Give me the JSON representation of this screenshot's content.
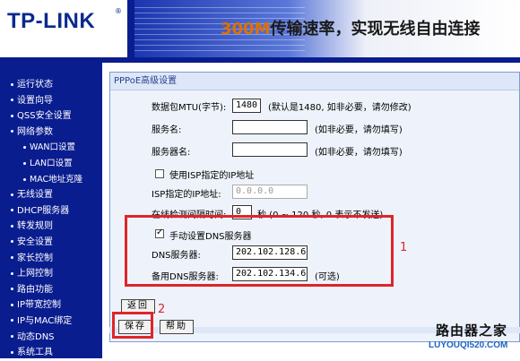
{
  "header": {
    "logo": "TP-LINK",
    "logo_mark": "®",
    "slogan_num": "300M",
    "slogan_text": "传输速率，实现无线自由连接"
  },
  "sidebar": {
    "items": [
      {
        "label": "运行状态",
        "sub": false
      },
      {
        "label": "设置向导",
        "sub": false
      },
      {
        "label": "QSS安全设置",
        "sub": false
      },
      {
        "label": "网络参数",
        "sub": false
      },
      {
        "label": "WAN口设置",
        "sub": true
      },
      {
        "label": "LAN口设置",
        "sub": true
      },
      {
        "label": "MAC地址克隆",
        "sub": true
      },
      {
        "label": "无线设置",
        "sub": false
      },
      {
        "label": "DHCP服务器",
        "sub": false
      },
      {
        "label": "转发规则",
        "sub": false
      },
      {
        "label": "安全设置",
        "sub": false
      },
      {
        "label": "家长控制",
        "sub": false
      },
      {
        "label": "上网控制",
        "sub": false
      },
      {
        "label": "路由功能",
        "sub": false
      },
      {
        "label": "IP带宽控制",
        "sub": false
      },
      {
        "label": "IP与MAC绑定",
        "sub": false
      },
      {
        "label": "动态DNS",
        "sub": false
      },
      {
        "label": "系统工具",
        "sub": false
      }
    ]
  },
  "panel": {
    "title": "PPPoE高级设置",
    "mtu_label": "数据包MTU(字节):",
    "mtu_value": "1480",
    "mtu_note": "(默认是1480, 如非必要，请勿修改)",
    "service_label": "服务名:",
    "service_note": "(如非必要，请勿填写)",
    "server_label": "服务器名:",
    "server_note": "(如非必要，请勿填写)",
    "isp_ip_check_label": "使用ISP指定的IP地址",
    "isp_ip_label": "ISP指定的IP地址:",
    "isp_ip_value": "0.0.0.0",
    "interval_label": "在线检测间隔时间:",
    "interval_value": "0",
    "interval_note": "秒 (0 ~ 120 秒, 0 表示不发送)",
    "dns_check_label": "手动设置DNS服务器",
    "dns_label": "DNS服务器:",
    "dns_value": "202.102.128.68",
    "dns2_label": "备用DNS服务器:",
    "dns2_value": "202.102.134.68",
    "dns2_note": "(可选)",
    "back_label": "返回",
    "save_label": "保存",
    "help_label": "帮助"
  },
  "annotations": {
    "num1": "1",
    "num2": "2"
  },
  "watermark": {
    "name": "路由器之家",
    "url": "LUYOUQI520.COM"
  },
  "colors": {
    "nav_bg": "#0a1d8f",
    "panel_bg": "#eef3fb",
    "annotation_red": "#e0242a"
  }
}
